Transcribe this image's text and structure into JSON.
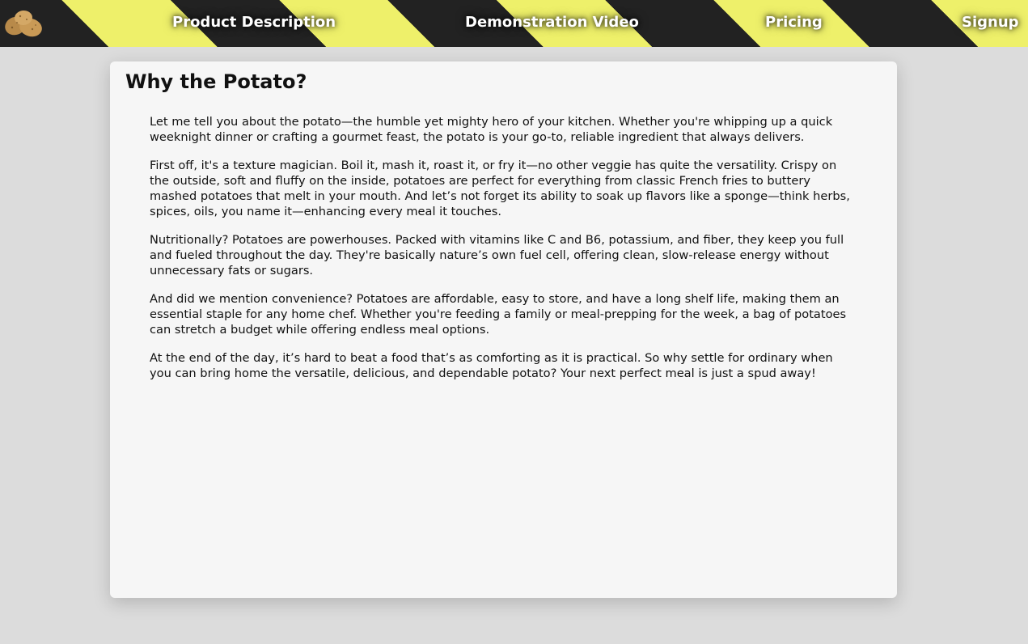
{
  "nav": {
    "logo_icon": "potato-logo-icon",
    "links": [
      {
        "label": "Product Description"
      },
      {
        "label": "Demonstration Video"
      },
      {
        "label": "Pricing"
      },
      {
        "label": "Signup"
      }
    ],
    "colors": {
      "stripe_dark": "#222222",
      "stripe_light": "#eef06a"
    }
  },
  "main": {
    "title": "Why the Potato?",
    "paragraphs": [
      "Let me tell you about the potato—the humble yet mighty hero of your kitchen. Whether you're whipping up a quick weeknight dinner or crafting a gourmet feast, the potato is your go-to, reliable ingredient that always delivers.",
      "First off, it's a texture magician. Boil it, mash it, roast it, or fry it—no other veggie has quite the versatility. Crispy on the outside, soft and fluffy on the inside, potatoes are perfect for everything from classic French fries to buttery mashed potatoes that melt in your mouth. And let’s not forget its ability to soak up flavors like a sponge—think herbs, spices, oils, you name it—enhancing every meal it touches.",
      "Nutritionally? Potatoes are powerhouses. Packed with vitamins like C and B6, potassium, and fiber, they keep you full and fueled throughout the day. They're basically nature’s own fuel cell, offering clean, slow-release energy without unnecessary fats or sugars.",
      "And did we mention convenience? Potatoes are affordable, easy to store, and have a long shelf life, making them an essential staple for any home chef. Whether you're feeding a family or meal-prepping for the week, a bag of potatoes can stretch a budget while offering endless meal options.",
      "At the end of the day, it’s hard to beat a food that’s as comforting as it is practical. So why settle for ordinary when you can bring home the versatile, delicious, and dependable potato? Your next perfect meal is just a spud away!"
    ]
  }
}
